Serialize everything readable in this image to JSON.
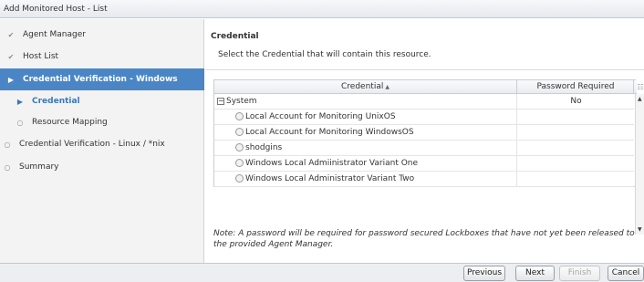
{
  "window": {
    "title": "Add Monitored Host - List"
  },
  "sidebar": {
    "items": [
      {
        "label": "Agent Manager",
        "icon": "check-icon"
      },
      {
        "label": "Host List",
        "icon": "check-icon"
      },
      {
        "label": "Credential Verification - Windows",
        "icon": "triangle-right-icon",
        "state": "active"
      },
      {
        "label": "Credential",
        "icon": "triangle-right-icon",
        "state": "sub-active"
      },
      {
        "label": "Resource Mapping",
        "icon": "dot-icon"
      },
      {
        "label": "Credential Verification - Linux / *nix",
        "icon": "dot-icon"
      },
      {
        "label": "Summary",
        "icon": "dot-icon"
      }
    ]
  },
  "main": {
    "section_title": "Credential",
    "instruction": "Select the Credential that will contain this resource.",
    "grid": {
      "columns": {
        "credential": "Credential",
        "sort_indicator": "▲",
        "password_required": "Password Required"
      },
      "group": {
        "toggle": "−",
        "label": "System",
        "password_required": "No"
      },
      "rows": [
        {
          "label": "Local Account for Monitoring UnixOS",
          "password_required": ""
        },
        {
          "label": "Local Account for Monitoring WindowsOS",
          "password_required": ""
        },
        {
          "label": "shodgins",
          "password_required": ""
        },
        {
          "label": "Windows Local Admiinistrator Variant One",
          "password_required": ""
        },
        {
          "label": "Windows Local Administrator Variant Two",
          "password_required": ""
        }
      ]
    },
    "note": "Note: A password will be required for password secured Lockboxes that have not yet been released to the provided Agent Manager."
  },
  "footer": {
    "previous": "Previous",
    "next": "Next",
    "finish": "Finish",
    "cancel": "Cancel"
  },
  "colors": {
    "active_nav_bg": "#4a86c5",
    "sub_active_text": "#3b78b8",
    "sidebar_bg": "#f3f3f3"
  }
}
